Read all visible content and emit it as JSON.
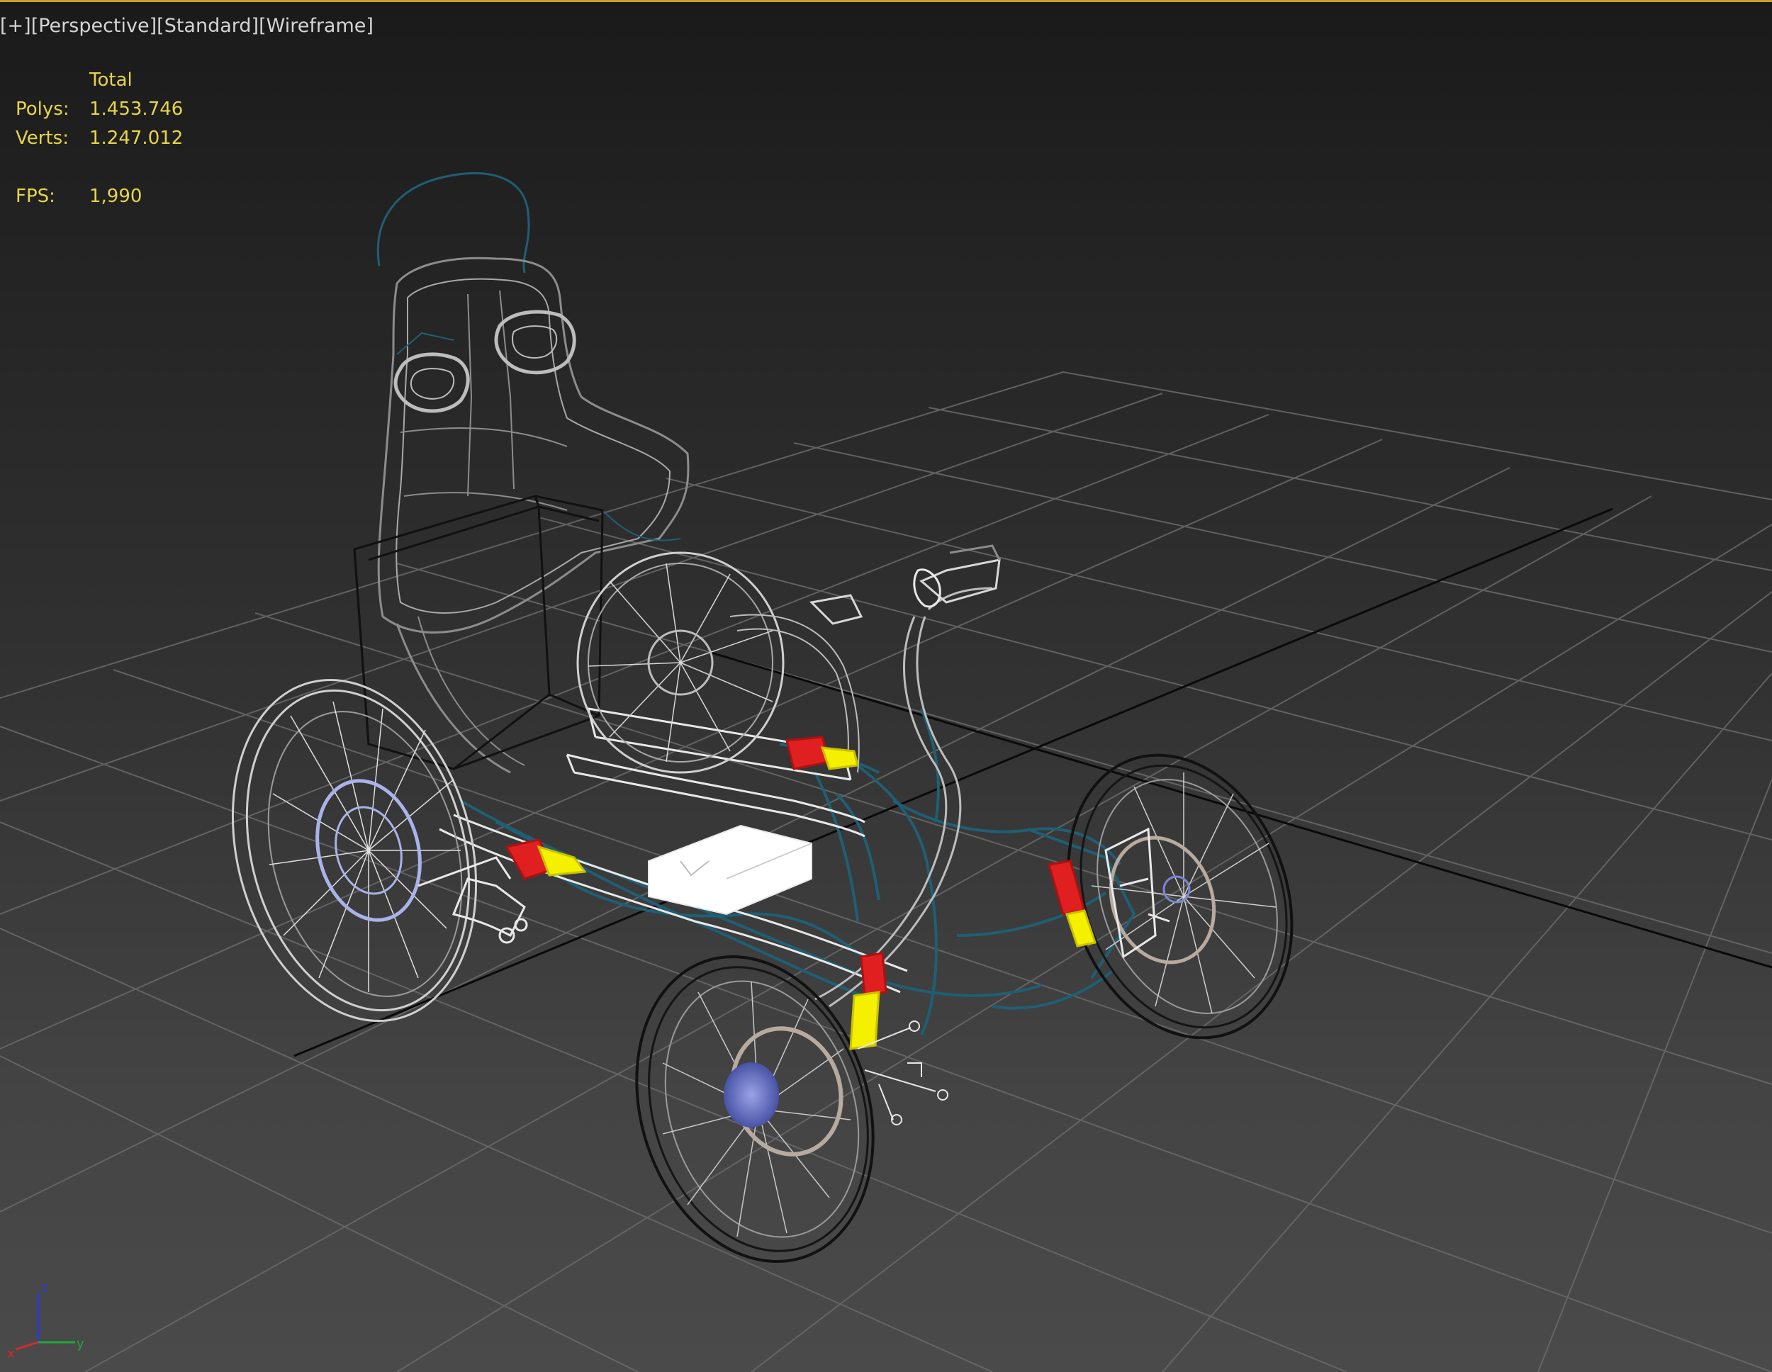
{
  "viewport": {
    "labels": [
      "[+]",
      "[Perspective]",
      "[Standard]",
      "[Wireframe]"
    ]
  },
  "stats": {
    "header": "Total",
    "polys_label": "Polys:",
    "polys_value": "1.453.746",
    "verts_label": "Verts:",
    "verts_value": "1.247.012",
    "fps_label": "FPS:",
    "fps_value": "1,990"
  },
  "axis": {
    "z_label": "z",
    "x_label": "x",
    "y_label": "y"
  },
  "colors": {
    "border_accent": "#c9a227",
    "stats_text": "#e7d44a",
    "label_text": "#d4d4d4",
    "grid": "#6a6a6a",
    "wire_white": "#e8e8e8",
    "wire_teal": "#1f5f74",
    "shock_red": "#e02020",
    "shock_yellow": "#f4f000",
    "hub_blue": "#7a86d8"
  }
}
